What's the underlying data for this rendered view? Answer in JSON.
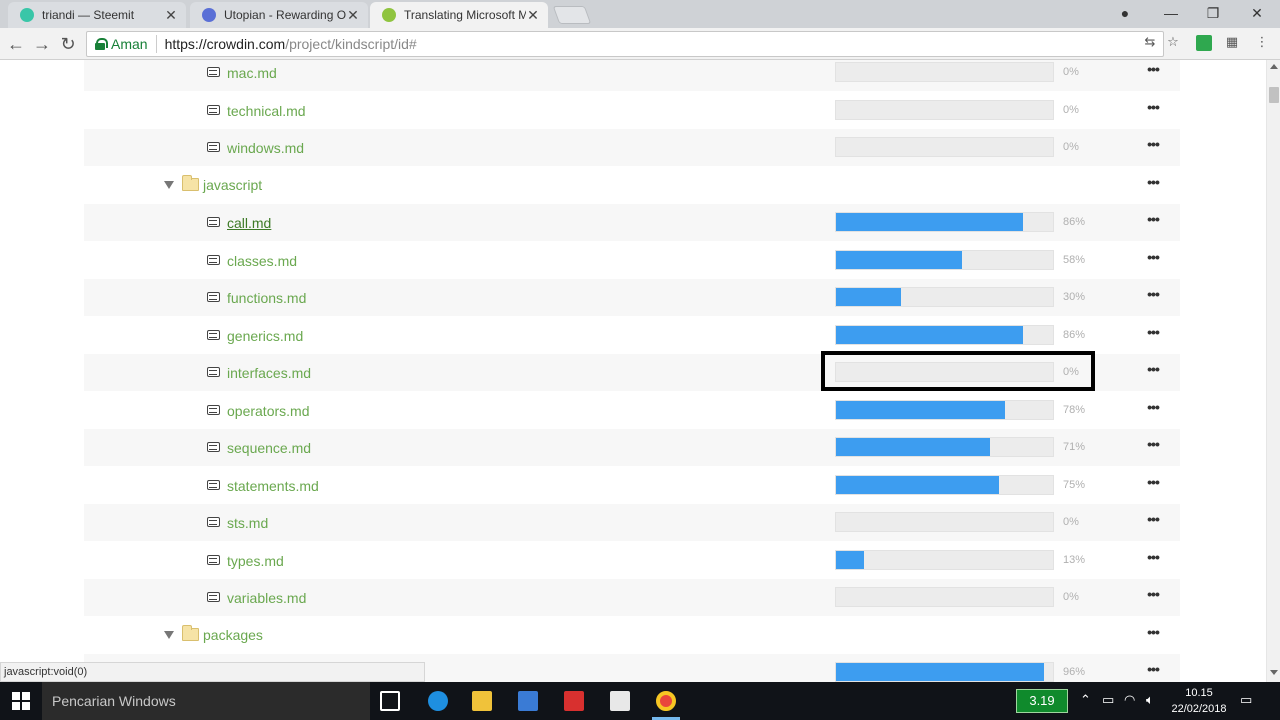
{
  "browser": {
    "tabs": [
      {
        "title": "triandi — Steemit",
        "fav_color": "#39c6a8"
      },
      {
        "title": "Utopian - Rewarding Op",
        "fav_color": "#5a6fd6"
      },
      {
        "title": "Translating Microsoft Ma",
        "fav_color": "#8fc43f"
      }
    ],
    "secure_label": "Aman",
    "url_host": "https://crowdin.com",
    "url_path": "/project/kindscript/id#"
  },
  "tree": [
    {
      "type": "file",
      "name": "mac.md",
      "percent": 0,
      "label": "0%",
      "shade": true
    },
    {
      "type": "file",
      "name": "technical.md",
      "percent": 0,
      "label": "0%",
      "shade": false
    },
    {
      "type": "file",
      "name": "windows.md",
      "percent": 0,
      "label": "0%",
      "shade": true
    },
    {
      "type": "folder",
      "name": "javascript",
      "shade": false
    },
    {
      "type": "file",
      "name": "call.md",
      "percent": 86,
      "label": "86%",
      "shade": true,
      "underline": true
    },
    {
      "type": "file",
      "name": "classes.md",
      "percent": 58,
      "label": "58%",
      "shade": false
    },
    {
      "type": "file",
      "name": "functions.md",
      "percent": 30,
      "label": "30%",
      "shade": true
    },
    {
      "type": "file",
      "name": "generics.md",
      "percent": 86,
      "label": "86%",
      "shade": false
    },
    {
      "type": "file",
      "name": "interfaces.md",
      "percent": 0,
      "label": "0%",
      "shade": true,
      "highlighted": true
    },
    {
      "type": "file",
      "name": "operators.md",
      "percent": 78,
      "label": "78%",
      "shade": false
    },
    {
      "type": "file",
      "name": "sequence.md",
      "percent": 71,
      "label": "71%",
      "shade": true
    },
    {
      "type": "file",
      "name": "statements.md",
      "percent": 75,
      "label": "75%",
      "shade": false
    },
    {
      "type": "file",
      "name": "sts.md",
      "percent": 0,
      "label": "0%",
      "shade": true
    },
    {
      "type": "file",
      "name": "types.md",
      "percent": 13,
      "label": "13%",
      "shade": false
    },
    {
      "type": "file",
      "name": "variables.md",
      "percent": 0,
      "label": "0%",
      "shade": true
    },
    {
      "type": "folder",
      "name": "packages",
      "shade": false
    },
    {
      "type": "file",
      "name": "",
      "percent": 96,
      "label": "96%",
      "shade": true
    }
  ],
  "status_url": "javascript:void(0)",
  "taskbar": {
    "search_placeholder": "Pencarian Windows",
    "battery_value": "3.19",
    "time": "10.15",
    "date": "22/02/2018"
  },
  "colors": {
    "accent": "#3d9df0",
    "link": "#6aa84f"
  }
}
